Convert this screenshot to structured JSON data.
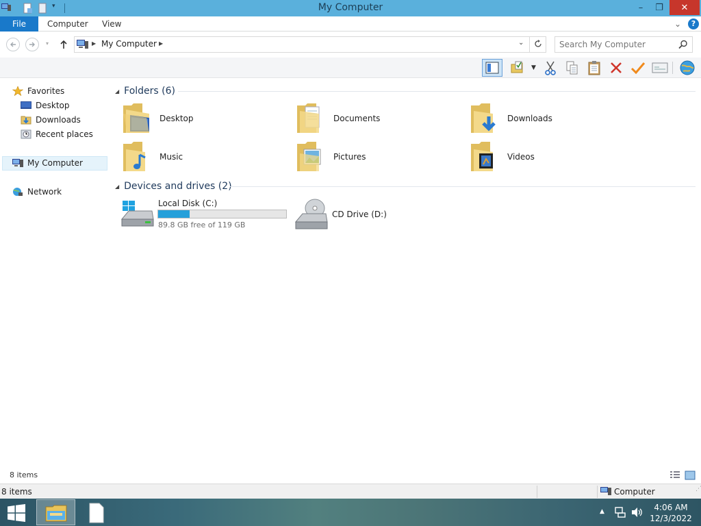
{
  "window": {
    "title": "My Computer",
    "minimize_glyph": "–",
    "restore_glyph": "❐",
    "close_glyph": "✕"
  },
  "ribbon": {
    "tabs": [
      "File",
      "Computer",
      "View"
    ],
    "expand_glyph": "⌄",
    "help_glyph": "?"
  },
  "address": {
    "location": "My Computer",
    "search_placeholder": "Search My Computer"
  },
  "toolbar": {
    "buttons": [
      "preview-pane",
      "folder-options",
      "cut",
      "copy",
      "paste",
      "delete",
      "rename",
      "properties",
      "internet"
    ]
  },
  "nav_pane": {
    "favorites_label": "Favorites",
    "favorites": [
      "Desktop",
      "Downloads",
      "Recent places"
    ],
    "computer_label": "My Computer",
    "network_label": "Network"
  },
  "content": {
    "folders_header": "Folders (6)",
    "folders": [
      "Desktop",
      "Documents",
      "Downloads",
      "Music",
      "Pictures",
      "Videos"
    ],
    "drives_header": "Devices and drives (2)",
    "drives": [
      {
        "name": "Local Disk (C:)",
        "free_text": "89.8 GB free of 119 GB",
        "used_fraction": 0.245
      },
      {
        "name": "CD Drive (D:)"
      }
    ]
  },
  "status": {
    "items_count": "8 items",
    "items_count_bottom": "8 items",
    "zone_label": "Computer"
  },
  "taskbar": {
    "time": "4:06 AM",
    "date": "12/3/2022"
  },
  "colors": {
    "titlebar": "#5ab0dc",
    "file_tab": "#1979ca",
    "close": "#c7362b",
    "drive_bar": "#26a0da",
    "header_text": "#1e395b"
  }
}
